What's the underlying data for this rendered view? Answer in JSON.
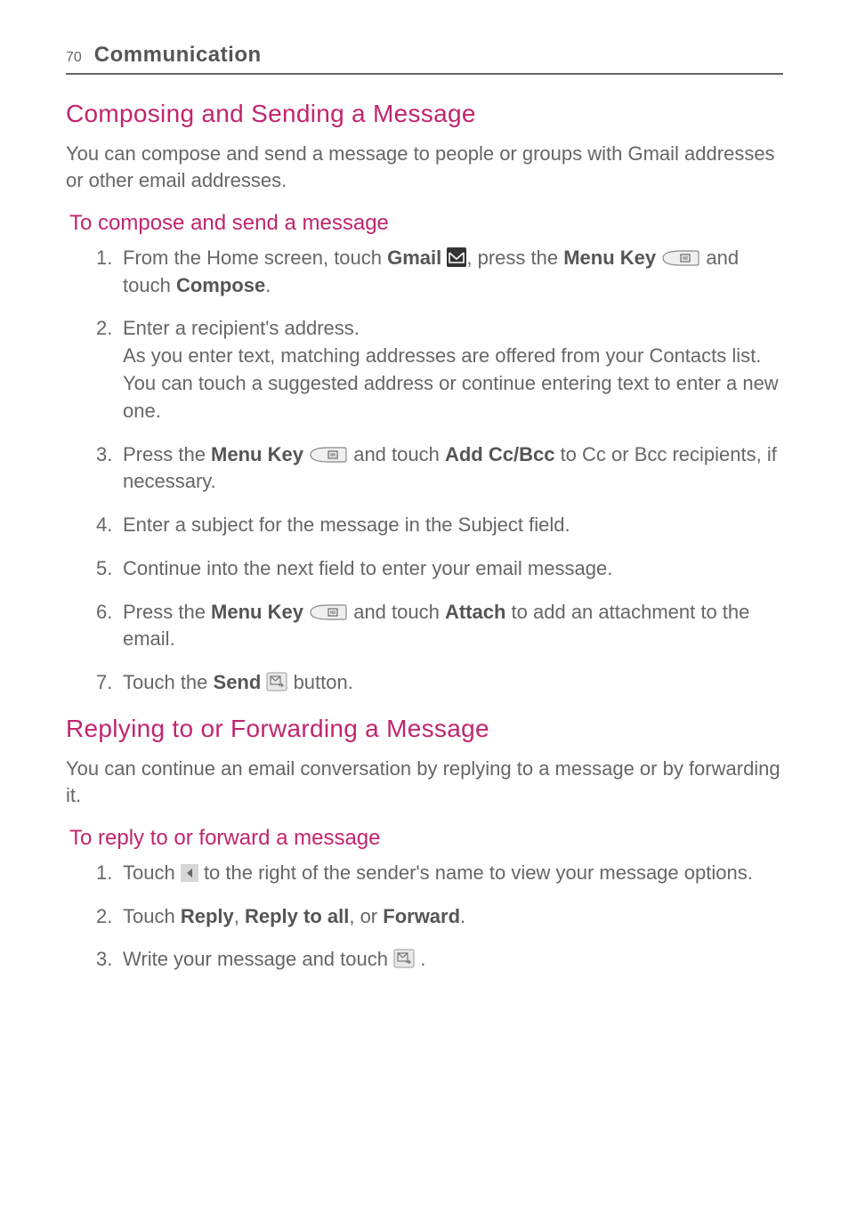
{
  "header": {
    "page_number": "70",
    "chapter": "Communication"
  },
  "section1": {
    "title": "Composing and Sending a Message",
    "intro": "You can compose and send a message to people or groups with Gmail addresses or other email addresses.",
    "subtitle": "To compose and send a message",
    "step1_a": "From the Home screen, touch ",
    "step1_gmail": "Gmail",
    "step1_b": ", press the ",
    "step1_menu": "Menu Key",
    "step1_c": " and touch ",
    "step1_compose": "Compose",
    "step1_d": ".",
    "step2_a": "Enter a recipient's address.",
    "step2_b": "As you enter text, matching addresses are offered from your Contacts list. You can touch a suggested address or continue entering text to enter a new one.",
    "step3_a": "Press the ",
    "step3_menu": "Menu Key",
    "step3_b": " and touch ",
    "step3_cc": "Add Cc/Bcc",
    "step3_c": " to Cc or Bcc recipients, if necessary.",
    "step4": "Enter a subject for the message in the Subject field.",
    "step5": "Continue into the next field to enter your email message.",
    "step6_a": "Press the ",
    "step6_menu": "Menu Key",
    "step6_b": " and touch ",
    "step6_attach": "Attach",
    "step6_c": " to add an attachment to the email.",
    "step7_a": "Touch the ",
    "step7_send": "Send",
    "step7_b": " button."
  },
  "section2": {
    "title": "Replying to or Forwarding a Message",
    "intro": "You can continue an email conversation by replying to a message or by forwarding it.",
    "subtitle": "To reply to or forward a message",
    "step1_a": "Touch ",
    "step1_b": " to the right of the sender's name to view your message options.",
    "step2_a": "Touch ",
    "step2_reply": "Reply",
    "step2_b": ", ",
    "step2_replyall": "Reply to all",
    "step2_c": ", or ",
    "step2_forward": "Forward",
    "step2_d": ".",
    "step3_a": "Write your message and touch ",
    "step3_b": " ."
  }
}
